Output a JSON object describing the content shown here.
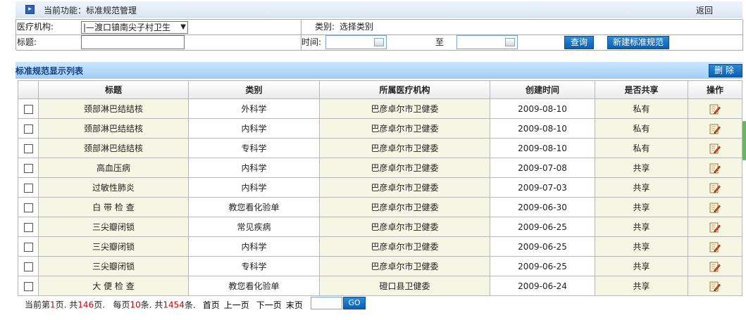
{
  "header": {
    "title": "当前功能：标准规范管理",
    "back_label": "返回"
  },
  "search": {
    "org_label": "医疗机构:",
    "org_value": "|—渡口镇南尖子村卫生",
    "category_label": "类别:",
    "category_value": "选择类别",
    "title_label": "标题:",
    "title_value": "",
    "time_label": "时间:",
    "time_from": "",
    "to_label": "至",
    "time_to": "",
    "query_label": "查询",
    "new_label": "新建标准规范"
  },
  "list": {
    "title": "标准规范显示列表",
    "delete_label": "删除",
    "columns": [
      "标题",
      "类别",
      "所属医疗机构",
      "创建时间",
      "是否共享",
      "操作"
    ],
    "rows": [
      {
        "title": "颈部淋巴结结核",
        "category": "外科学",
        "org": "巴彦卓尔市卫健委",
        "date": "2009-08-10",
        "share": "私有"
      },
      {
        "title": "颈部淋巴结结核",
        "category": "内科学",
        "org": "巴彦卓尔市卫健委",
        "date": "2009-08-10",
        "share": "私有"
      },
      {
        "title": "颈部淋巴结结核",
        "category": "专科学",
        "org": "巴彦卓尔市卫健委",
        "date": "2009-08-10",
        "share": "私有"
      },
      {
        "title": "高血压病",
        "category": "内科学",
        "org": "巴彦卓尔市卫健委",
        "date": "2009-07-08",
        "share": "共享"
      },
      {
        "title": "过敏性肺炎",
        "category": "内科学",
        "org": "巴彦卓尔市卫健委",
        "date": "2009-07-03",
        "share": "共享"
      },
      {
        "title": "白 带 检 查",
        "category": "教您看化验单",
        "org": "巴彦卓尔市卫健委",
        "date": "2009-06-30",
        "share": "共享"
      },
      {
        "title": "三尖瓣闭锁",
        "category": "常见疾病",
        "org": "巴彦卓尔市卫健委",
        "date": "2009-06-25",
        "share": "共享"
      },
      {
        "title": "三尖瓣闭锁",
        "category": "内科学",
        "org": "巴彦卓尔市卫健委",
        "date": "2009-06-25",
        "share": "共享"
      },
      {
        "title": "三尖瓣闭锁",
        "category": "专科学",
        "org": "巴彦卓尔市卫健委",
        "date": "2009-06-25",
        "share": "共享"
      },
      {
        "title": "大 便 检 查",
        "category": "教您看化验单",
        "org": "磴口县卫健委",
        "date": "2009-06-24",
        "share": "共享"
      }
    ]
  },
  "pager": {
    "prefix": "当前第",
    "current": "1",
    "mid1": "页. 共",
    "total_pages": "146",
    "mid2": "页.   每页",
    "per_page": "10",
    "mid3": "条. 共",
    "total_items": "1454",
    "suffix": "条.",
    "first": "首页",
    "prev": "上一页",
    "next": "下一页",
    "last": "末页",
    "page_input": "",
    "go_label": "GO"
  },
  "colors": {
    "accent": "#0d5fb0",
    "row_bg": "#f6f6e4",
    "count_red": "#d00000"
  }
}
